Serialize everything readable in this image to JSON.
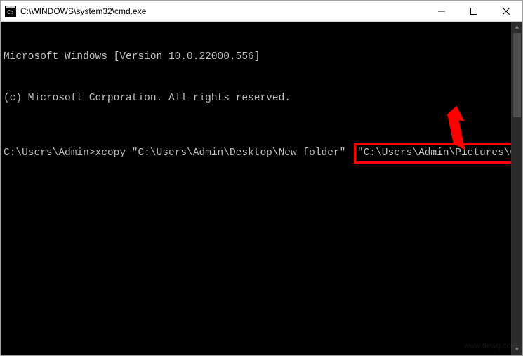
{
  "window": {
    "title": "C:\\WINDOWS\\system32\\cmd.exe"
  },
  "terminal": {
    "line1": "Microsoft Windows [Version 10.0.22000.556]",
    "line2": "(c) Microsoft Corporation. All rights reserved.",
    "prompt": "C:\\Users\\Admin>",
    "command": "xcopy \"C:\\Users\\Admin\\Desktop\\New folder\" ",
    "highlighted_arg": "\"C:\\Users\\Admin\\Pictures\\Copy\""
  },
  "colors": {
    "highlight_border": "#ff0000",
    "terminal_bg": "#000000",
    "terminal_fg": "#c0c0c0"
  },
  "watermark": "www.dewq.com"
}
